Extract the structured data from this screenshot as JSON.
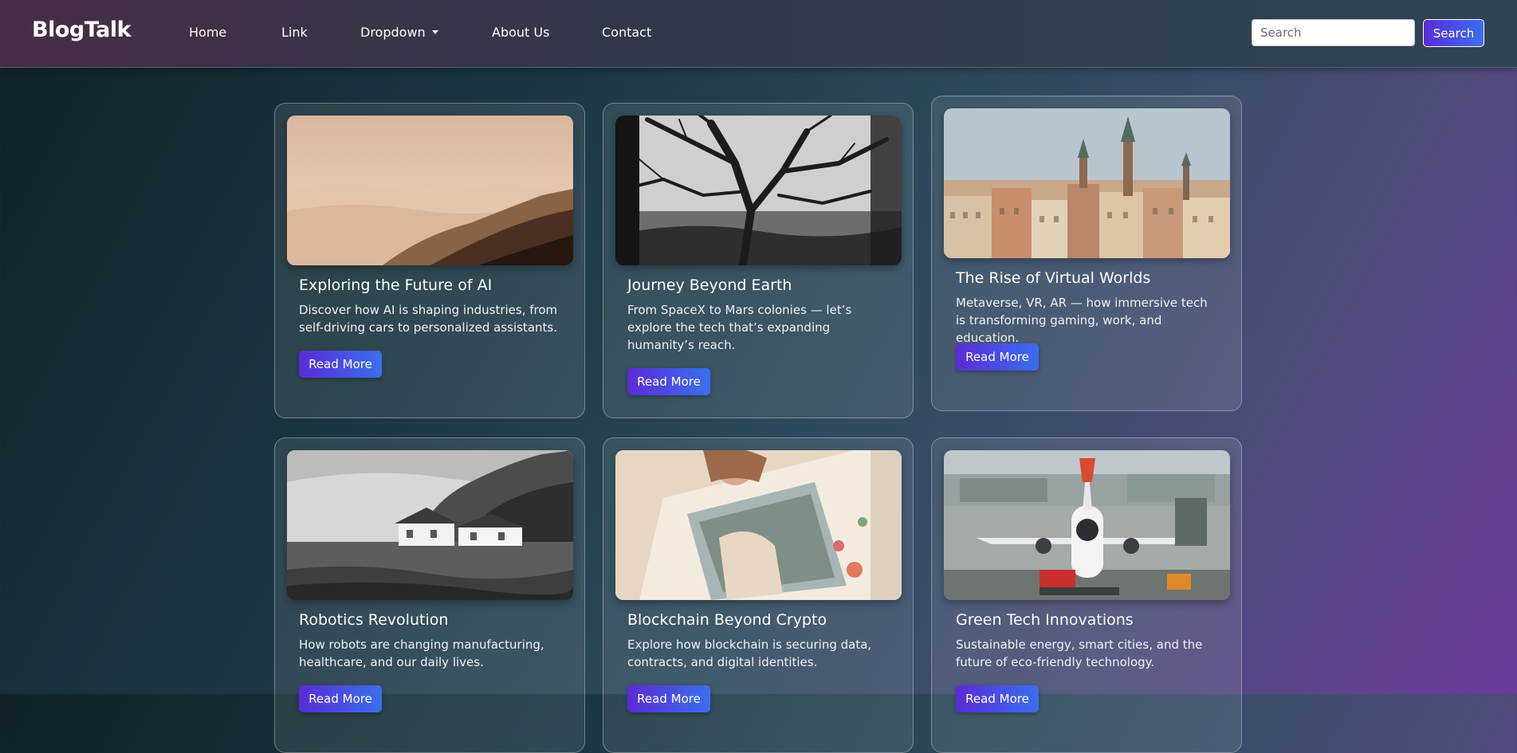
{
  "navbar": {
    "brand": "BlogTalk",
    "links": [
      "Home",
      "Link",
      "Dropdown",
      "About Us",
      "Contact"
    ],
    "search": {
      "placeholder": "Search",
      "button_label": "Search"
    }
  },
  "cards": [
    {
      "title": "Exploring the Future of AI",
      "text": "Discover how AI is shaping industries, from self-driving cars to personalized assistants.",
      "button": "Read More",
      "image": "misty-hills-photo"
    },
    {
      "title": "Journey Beyond Earth",
      "text": "From SpaceX to Mars colonies — let’s explore the tech that’s expanding humanity’s reach.",
      "button": "Read More",
      "image": "bare-trees-photo"
    },
    {
      "title": "The Rise of Virtual Worlds",
      "text": "Metaverse, VR, AR — how immersive tech is transforming gaming, work, and education.",
      "button": "Read More",
      "image": "city-skyline-photo"
    },
    {
      "title": "Robotics Revolution",
      "text": "How robots are changing manufacturing, healthcare, and our daily lives.",
      "button": "Read More",
      "image": "coastal-cottages-photo"
    },
    {
      "title": "Blockchain Beyond Crypto",
      "text": "Explore how blockchain is securing data, contracts, and digital identities.",
      "button": "Read More",
      "image": "woman-in-window-photo"
    },
    {
      "title": "Green Tech Innovations",
      "text": "Sustainable energy, smart cities, and the future of eco-friendly technology.",
      "button": "Read More",
      "image": "airport-plane-photo"
    }
  ],
  "colors": {
    "accent_gradient_start": "#5a2bd6",
    "accent_gradient_end": "#3a6ff0",
    "page_gradient_end": "#6b3a9c"
  }
}
